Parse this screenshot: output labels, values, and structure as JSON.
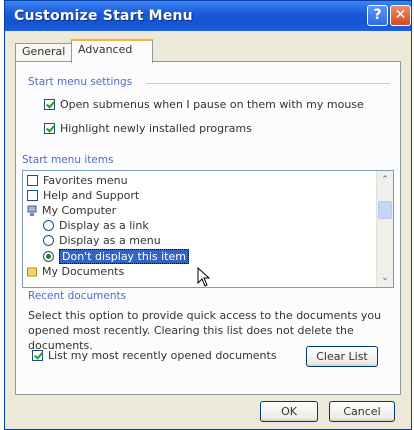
{
  "window": {
    "title": "Customize Start Menu",
    "help_glyph": "?",
    "close_glyph": "✕"
  },
  "tabs": [
    {
      "label": "General",
      "selected": false
    },
    {
      "label": "Advanced",
      "selected": true
    }
  ],
  "settings": {
    "group_label": "Start menu settings",
    "options": [
      {
        "label": "Open submenus when I pause on them with my mouse",
        "checked": true
      },
      {
        "label": "Highlight newly installed programs",
        "checked": true
      }
    ]
  },
  "items": {
    "group_label": "Start menu items",
    "list": [
      {
        "label": "Favorites menu",
        "kind": "checkbox",
        "checked": false
      },
      {
        "label": "Help and Support",
        "kind": "checkbox",
        "checked": false
      },
      {
        "label": "My Computer",
        "kind": "folder-icon"
      },
      {
        "label": "Display as a link",
        "kind": "radio",
        "selected": false
      },
      {
        "label": "Display as a menu",
        "kind": "radio",
        "selected": false
      },
      {
        "label": "Don't display this item",
        "kind": "radio",
        "selected": true
      },
      {
        "label": "My Documents",
        "kind": "folder-icon"
      }
    ],
    "scroll_up_glyph": "⌃",
    "scroll_down_glyph": "⌄"
  },
  "recent": {
    "group_label": "Recent documents",
    "description": "Select this option to provide quick access to the documents you opened most recently. Clearing this list does not delete the documents.",
    "checkbox_label": "List my most recently opened documents",
    "checked": true,
    "clear_button": "Clear List"
  },
  "footer": {
    "ok": "OK",
    "cancel": "Cancel"
  },
  "colors": {
    "titlebar": "#1d5ad9",
    "selection": "#3163c5",
    "group_label": "#4b6fbf"
  }
}
